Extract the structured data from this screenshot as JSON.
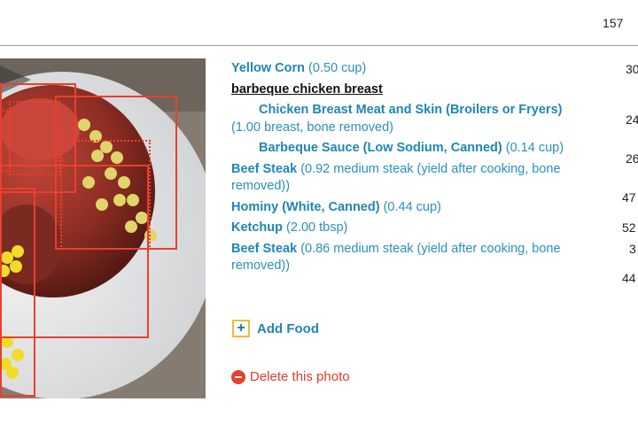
{
  "header": {
    "total_calories": "157"
  },
  "photo": {
    "alt": "photo of barbeque chicken with corn on a plate"
  },
  "groups": [
    {
      "label": "barbeque chicken breast"
    }
  ],
  "items": [
    {
      "name": "Yellow Corn",
      "qty": "(0.50 cup)",
      "cal": "30"
    },
    {
      "name": "Chicken Breast Meat and Skin (Broilers or Fryers)",
      "qty": "(1.00 breast, bone removed)",
      "cal": "24"
    },
    {
      "name": "Barbeque Sauce (Low Sodium, Canned)",
      "qty": "(0.14 cup)",
      "cal": "26"
    },
    {
      "name": "Beef Steak",
      "qty": "(0.92 medium steak (yield after cooking, bone removed))",
      "cal": "47"
    },
    {
      "name": "Hominy (White, Canned)",
      "qty": "(0.44 cup)",
      "cal": "52"
    },
    {
      "name": "Ketchup",
      "qty": "(2.00 tbsp)",
      "cal": "3"
    },
    {
      "name": "Beef Steak",
      "qty": "(0.86 medium steak (yield after cooking, bone removed))",
      "cal": "44"
    }
  ],
  "actions": {
    "add_food_label": "Add Food",
    "add_icon_glyph": "+",
    "delete_label": "Delete this photo"
  },
  "colors": {
    "link_blue": "#1f86b8",
    "box_red": "#e8402e",
    "add_border": "#f0b93a",
    "delete_red": "#e23b2a"
  }
}
